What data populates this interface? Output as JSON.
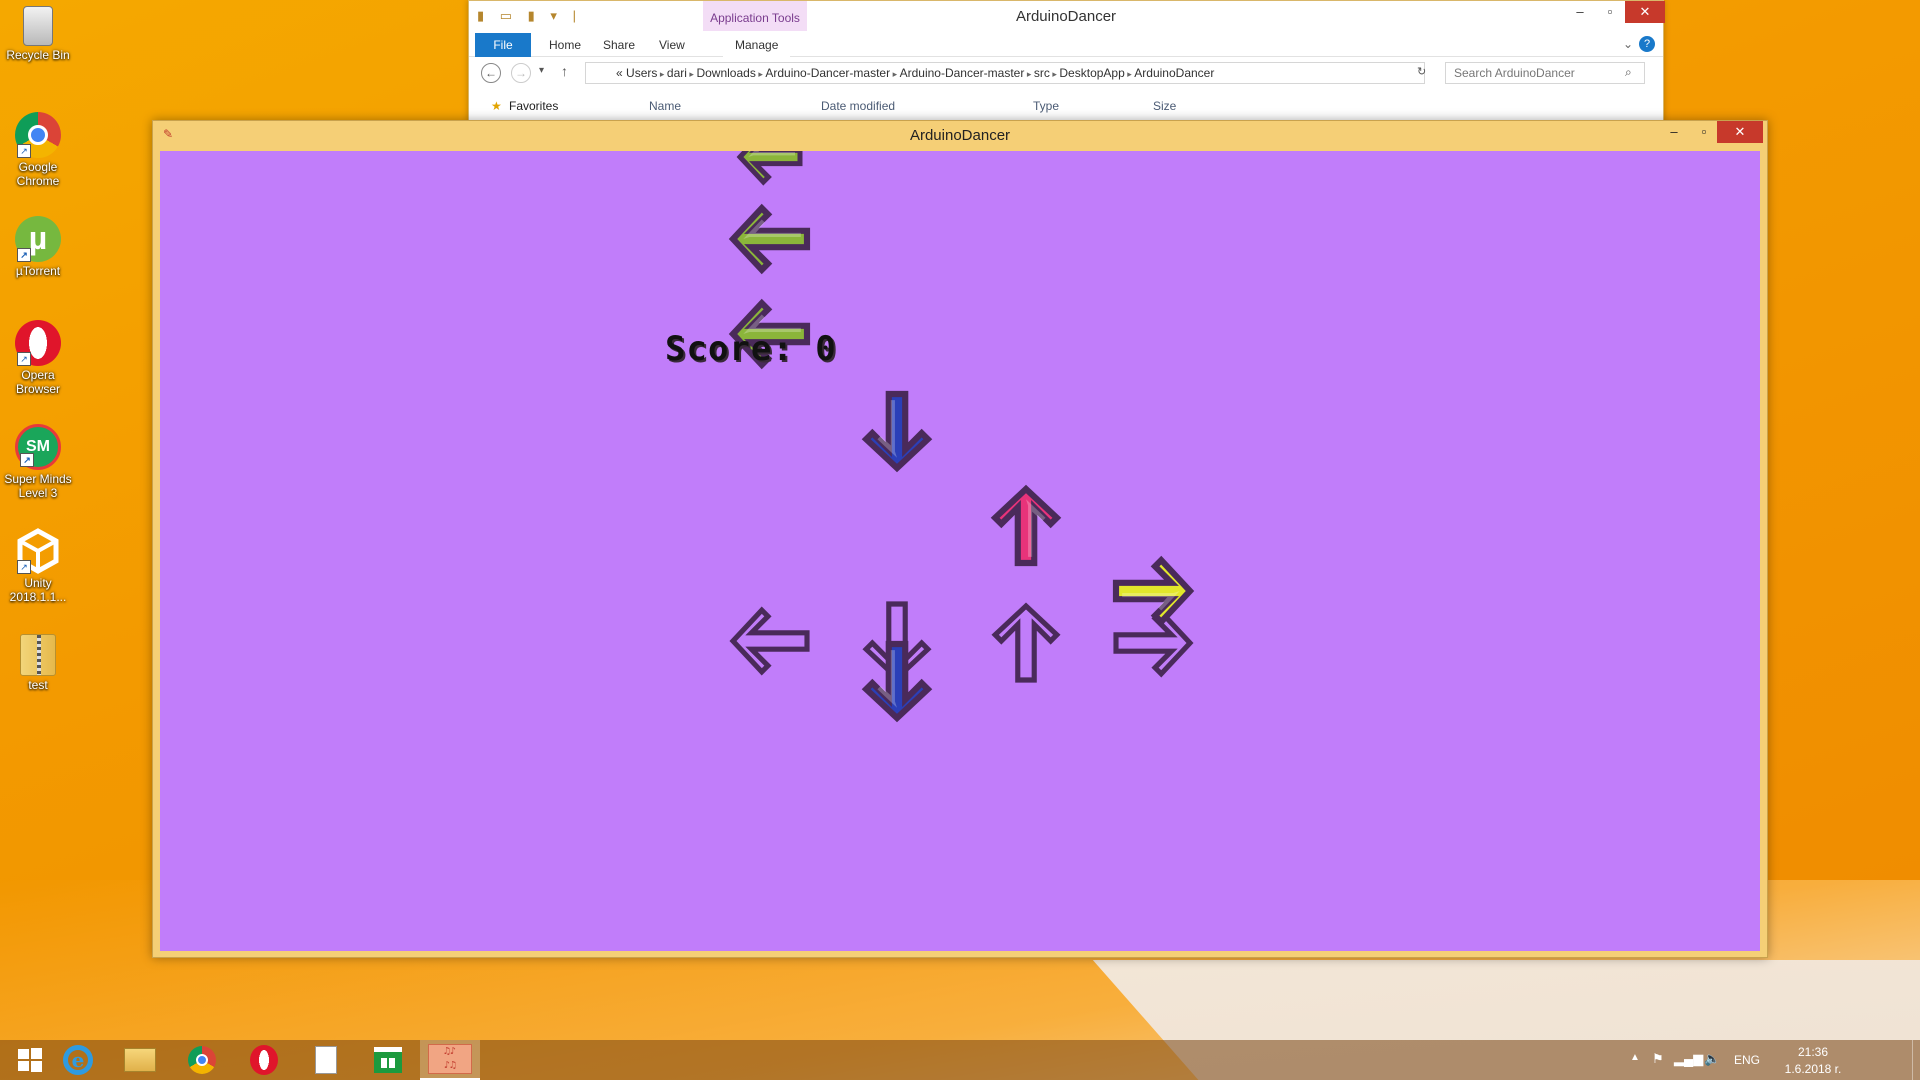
{
  "desktop": {
    "icons": [
      {
        "label": "Recycle Bin",
        "icon": "recycle-bin-icon"
      },
      {
        "label": "Google Chrome",
        "icon": "chrome-icon"
      },
      {
        "label": "µTorrent",
        "icon": "utorrent-icon"
      },
      {
        "label": "Opera Browser",
        "icon": "opera-icon"
      },
      {
        "label": "Super Minds Level 3",
        "icon": "superminds-icon"
      },
      {
        "label": "Unity 2018.1.1...",
        "icon": "unity-icon"
      },
      {
        "label": "test",
        "icon": "zip-folder-icon"
      }
    ]
  },
  "explorer": {
    "title": "ArduinoDancer",
    "context_tab": "Application Tools",
    "tabs": [
      "File",
      "Home",
      "Share",
      "View",
      "Manage"
    ],
    "breadcrumb": [
      "«",
      "Users",
      "dari",
      "Downloads",
      "Arduino-Dancer-master",
      "Arduino-Dancer-master",
      "src",
      "DesktopApp",
      "ArduinoDancer"
    ],
    "search_placeholder": "Search ArduinoDancer",
    "nav_favorites": "Favorites",
    "columns": [
      "Name",
      "Date modified",
      "Type",
      "Size"
    ]
  },
  "game": {
    "title": "ArduinoDancer",
    "score_label": "Score: 0",
    "colors": {
      "background": "#c17dfa",
      "left": "#8bb53a",
      "down": "#2b3fb8",
      "up": "#e8337a",
      "right": "#e2e72b",
      "outline": "#4a2a5a"
    }
  },
  "taskbar": {
    "apps": [
      "start-icon",
      "internet-explorer-icon",
      "file-explorer-icon",
      "chrome-icon",
      "opera-icon",
      "notepad-icon",
      "store-icon",
      "arduino-dancer-icon"
    ],
    "language": "ENG",
    "time": "21:36",
    "date": "1.6.2018 r."
  }
}
